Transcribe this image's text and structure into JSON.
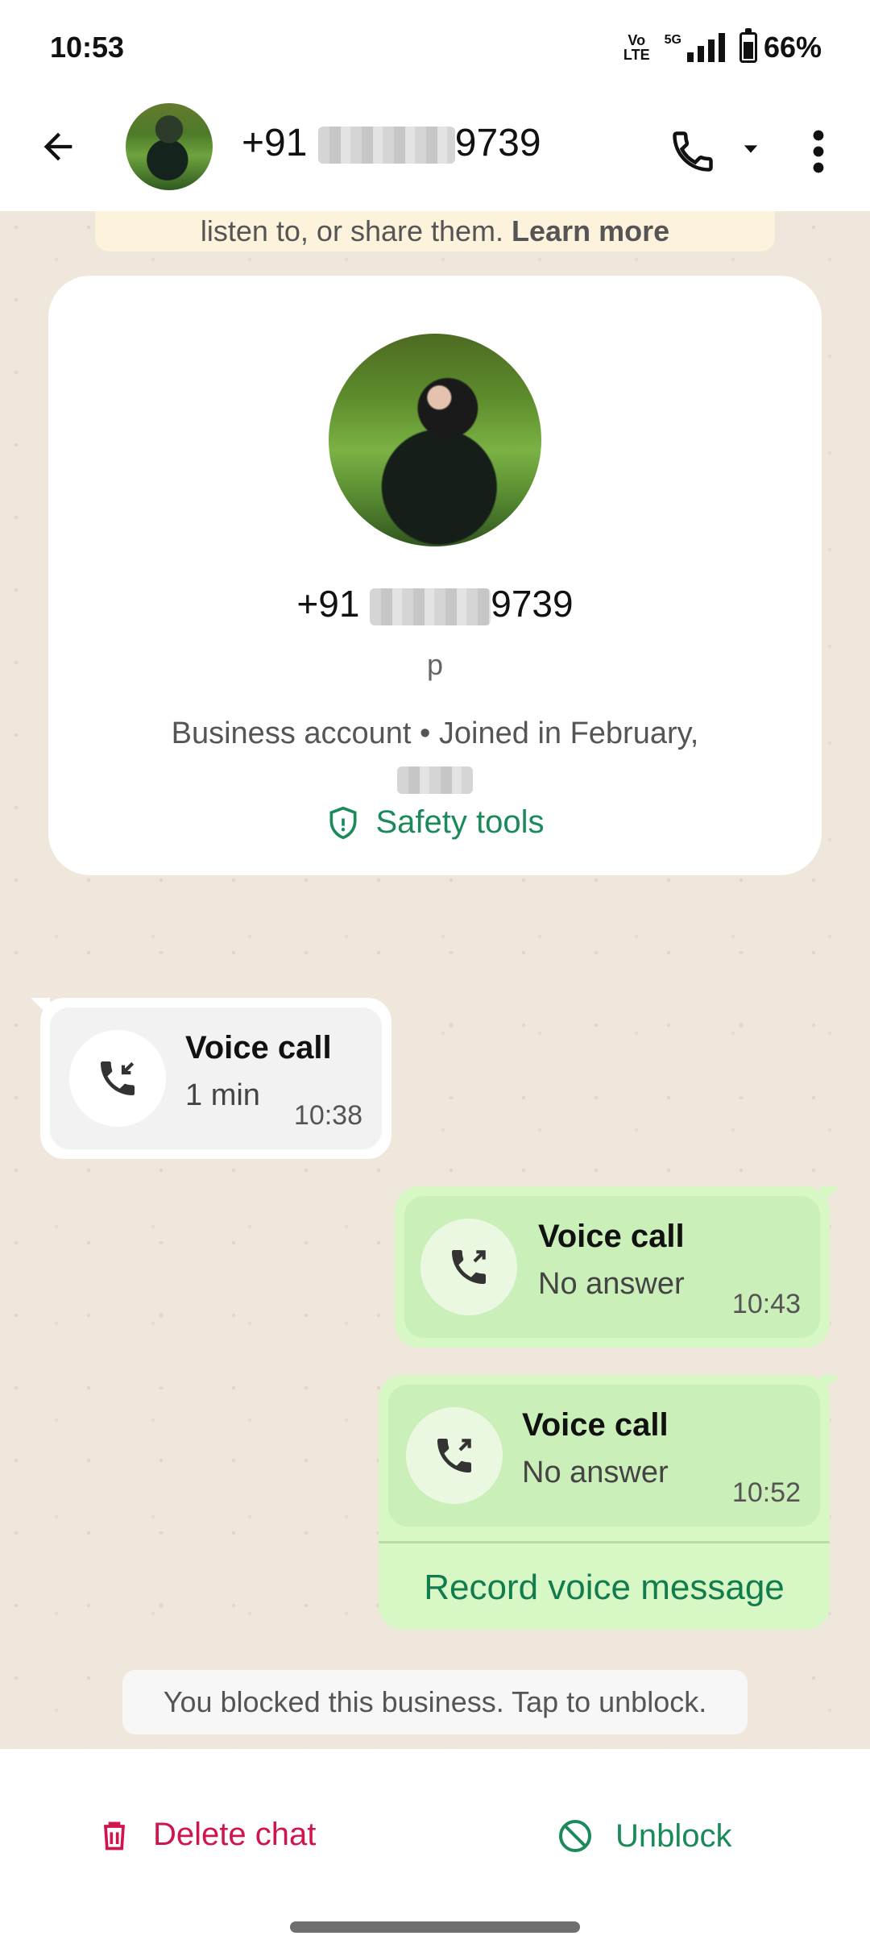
{
  "status": {
    "time": "10:53",
    "network_top": "Vo",
    "network_bottom": "LTE",
    "network_gen": "5G",
    "battery_percent": "66%"
  },
  "header": {
    "phone_prefix": "+91",
    "phone_suffix": "9739"
  },
  "encryption": {
    "text": "listen to, or share them.",
    "link": "Learn more"
  },
  "profile": {
    "phone_prefix": "+91",
    "phone_suffix": "9739",
    "name": "p",
    "account_type": "Business account",
    "separator": "•",
    "joined": "Joined in February,",
    "safety_tools": "Safety tools"
  },
  "calls": [
    {
      "title": "Voice call",
      "subtitle": "1 min",
      "time": "10:38",
      "direction": "incoming"
    },
    {
      "title": "Voice call",
      "subtitle": "No answer",
      "time": "10:43",
      "direction": "outgoing"
    },
    {
      "title": "Voice call",
      "subtitle": "No answer",
      "time": "10:52",
      "direction": "outgoing"
    }
  ],
  "record_voice_message": "Record voice message",
  "blocked_notice": "You blocked this business. Tap to unblock.",
  "actions": {
    "delete": "Delete chat",
    "unblock": "Unblock"
  },
  "colors": {
    "accent_green": "#1b8a5a",
    "danger_red": "#d0144c",
    "chat_bg": "#efe7dc",
    "outgoing_bubble": "#d7f8c4"
  }
}
